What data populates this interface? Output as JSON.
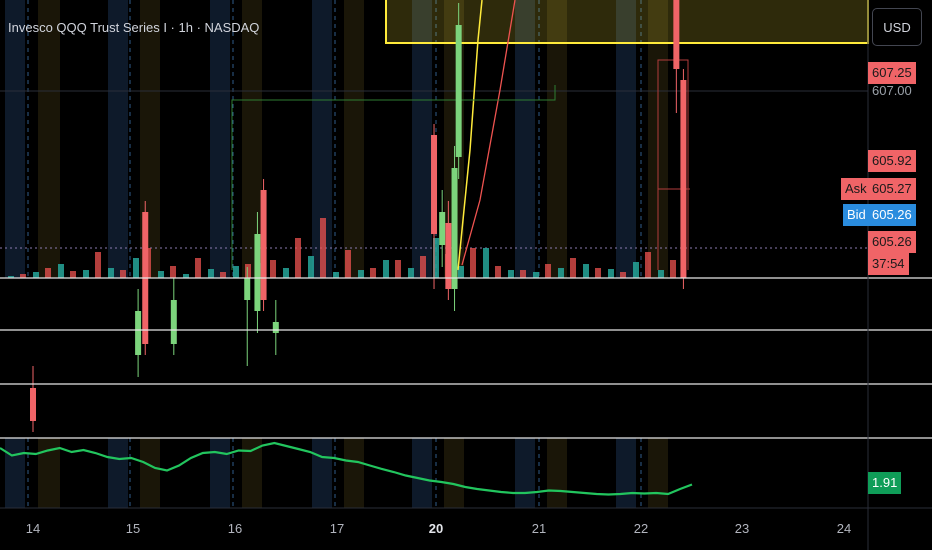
{
  "header": {
    "title": "Invesco QQQ Trust Series I · 1h · NASDAQ",
    "currency": "USD"
  },
  "price_scale": {
    "labels": [
      {
        "text": "607.25",
        "style": "red"
      },
      {
        "text": "607.00",
        "style": "plain"
      },
      {
        "text": "605.92",
        "style": "red"
      },
      {
        "text": "605.27",
        "style": "red"
      },
      {
        "text": "605.26",
        "style": "blue"
      },
      {
        "text": "605.26",
        "style": "red"
      },
      {
        "text": "37:54",
        "style": "red"
      }
    ],
    "ask_label": "Ask",
    "bid_label": "Bid",
    "indicator_value": "1.91"
  },
  "x_axis": {
    "ticks": [
      {
        "label": "14",
        "bold": false
      },
      {
        "label": "15",
        "bold": false
      },
      {
        "label": "16",
        "bold": false
      },
      {
        "label": "17",
        "bold": false
      },
      {
        "label": "20",
        "bold": true
      },
      {
        "label": "21",
        "bold": false
      },
      {
        "label": "22",
        "bold": false
      },
      {
        "label": "23",
        "bold": false
      },
      {
        "label": "24",
        "bold": false
      }
    ]
  },
  "colors": {
    "up": "#26a69a",
    "down": "#ef5350",
    "candle_up": "#7cd47c",
    "candle_down": "#f06467",
    "indicator_line": "#22c55e",
    "highlight_box": "#ffeb3b",
    "ask_bg": "#f06467",
    "bid_bg": "#2a8cde"
  },
  "chart_data": {
    "type": "candlestick",
    "symbol": "Invesco QQQ Trust Series I",
    "interval": "1h",
    "exchange": "NASDAQ",
    "x_ticks": [
      "14",
      "15",
      "16",
      "17",
      "20",
      "21",
      "22",
      "23",
      "24"
    ],
    "last_price": 605.26,
    "ask": 605.27,
    "bid": 605.26,
    "price_levels_shown": [
      607.25,
      607.0,
      605.92,
      605.27,
      605.26,
      605.26
    ],
    "candles": [
      {
        "x": 0.0,
        "o": 604.3,
        "h": 604.5,
        "l": 603.9,
        "c": 604.0
      },
      {
        "x": 1.05,
        "o": 604.6,
        "h": 605.2,
        "l": 604.4,
        "c": 605.0
      },
      {
        "x": 1.12,
        "o": 605.9,
        "h": 606.0,
        "l": 604.6,
        "c": 604.7
      },
      {
        "x": 1.4,
        "o": 604.7,
        "h": 605.3,
        "l": 604.6,
        "c": 605.1
      },
      {
        "x": 2.12,
        "o": 605.1,
        "h": 605.4,
        "l": 604.5,
        "c": 605.3
      },
      {
        "x": 2.22,
        "o": 605.0,
        "h": 605.9,
        "l": 604.8,
        "c": 605.7
      },
      {
        "x": 2.28,
        "o": 606.1,
        "h": 606.2,
        "l": 605.0,
        "c": 605.1
      },
      {
        "x": 2.4,
        "o": 604.8,
        "h": 605.1,
        "l": 604.6,
        "c": 604.9
      },
      {
        "x": 3.98,
        "o": 606.6,
        "h": 606.7,
        "l": 605.2,
        "c": 605.7
      },
      {
        "x": 4.06,
        "o": 605.6,
        "h": 606.1,
        "l": 605.4,
        "c": 605.9
      },
      {
        "x": 4.12,
        "o": 605.8,
        "h": 606.0,
        "l": 605.1,
        "c": 605.2
      },
      {
        "x": 4.18,
        "o": 605.2,
        "h": 606.5,
        "l": 605.0,
        "c": 606.3
      },
      {
        "x": 4.22,
        "o": 606.4,
        "h": 607.8,
        "l": 606.2,
        "c": 607.6
      },
      {
        "x": 6.35,
        "o": 607.9,
        "h": 608.0,
        "l": 606.8,
        "c": 607.2
      },
      {
        "x": 6.42,
        "o": 607.1,
        "h": 607.2,
        "l": 605.2,
        "c": 605.3
      }
    ],
    "volume": {
      "up": [
        2,
        6,
        14,
        8,
        10,
        20,
        7,
        4,
        9,
        12,
        15,
        10,
        22,
        6,
        8,
        18,
        10,
        40,
        12,
        30,
        8,
        6,
        10,
        14,
        9,
        16,
        8
      ],
      "down": [
        4,
        10,
        7,
        26,
        8,
        30,
        12,
        20,
        6,
        14,
        18,
        40,
        60,
        28,
        10,
        18,
        22,
        24,
        30,
        12,
        8,
        14,
        20,
        10,
        6,
        26,
        18
      ]
    },
    "indicator": {
      "type": "line",
      "last_value": 1.91,
      "values": [
        2.4,
        2.25,
        2.3,
        2.28,
        2.35,
        2.4,
        2.32,
        2.36,
        2.3,
        2.22,
        2.18,
        2.2,
        2.12,
        2.0,
        1.95,
        2.05,
        2.2,
        2.3,
        2.32,
        2.28,
        2.35,
        2.34,
        2.45,
        2.5,
        2.44,
        2.38,
        2.32,
        2.22,
        2.2,
        2.15,
        2.12,
        2.05,
        1.98,
        1.92,
        1.85,
        1.8,
        1.75,
        1.72,
        1.68,
        1.62,
        1.58,
        1.55,
        1.52,
        1.5,
        1.5,
        1.52,
        1.55,
        1.54,
        1.52,
        1.5,
        1.48,
        1.47,
        1.48,
        1.5,
        1.49,
        1.5,
        1.48,
        1.58,
        1.67
      ]
    }
  }
}
